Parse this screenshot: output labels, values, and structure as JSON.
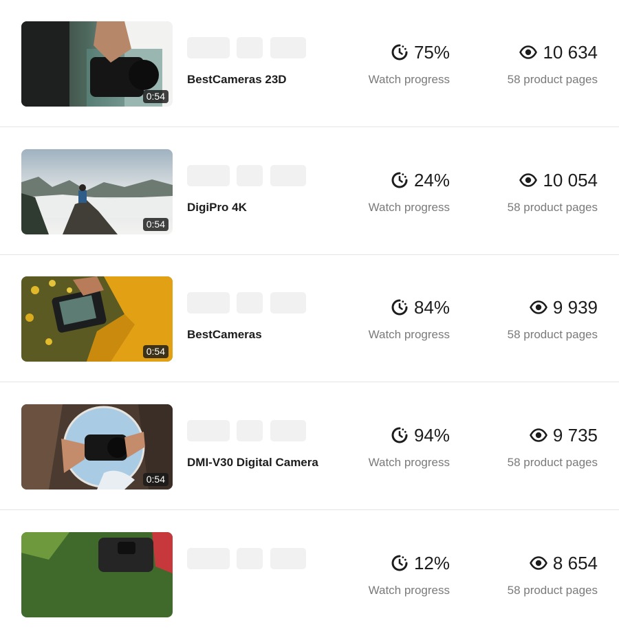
{
  "videos": [
    {
      "duration": "0:54",
      "title": "BestCameras 23D",
      "watch_progress": "75%",
      "watch_label": "Watch progress",
      "views": "10 634",
      "pages_label": "58 product pages"
    },
    {
      "duration": "0:54",
      "title": "DigiPro 4K",
      "watch_progress": "24%",
      "watch_label": "Watch progress",
      "views": "10 054",
      "pages_label": "58 product pages"
    },
    {
      "duration": "0:54",
      "title": "BestCameras",
      "watch_progress": "84%",
      "watch_label": "Watch progress",
      "views": "9 939",
      "pages_label": "58 product pages"
    },
    {
      "duration": "0:54",
      "title": "DMI-V30 Digital Camera",
      "watch_progress": "94%",
      "watch_label": "Watch progress",
      "views": "9 735",
      "pages_label": "58 product pages"
    },
    {
      "duration": "",
      "title": "",
      "watch_progress": "12%",
      "watch_label": "Watch progress",
      "views": "8 654",
      "pages_label": "58 product pages"
    }
  ],
  "icons": {
    "progress": "watch-progress-icon",
    "views": "eye-icon"
  },
  "colors": {
    "text": "#1c1c1c",
    "muted": "#7a7a7a",
    "chip": "#f1f1f2",
    "divider": "#e4e4e4"
  }
}
